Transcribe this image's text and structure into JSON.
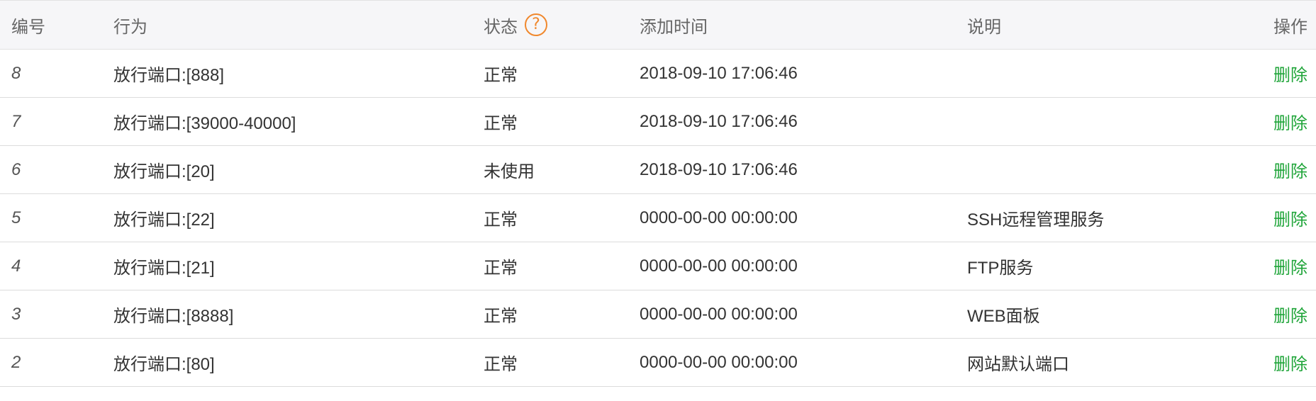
{
  "table": {
    "headers": {
      "id": "编号",
      "action": "行为",
      "status": "状态",
      "help_icon": "?",
      "time": "添加时间",
      "desc": "说明",
      "op": "操作"
    },
    "rows": [
      {
        "id": "8",
        "action": "放行端口:[888]",
        "status": "正常",
        "time": "2018-09-10 17:06:46",
        "desc": "",
        "op": "删除"
      },
      {
        "id": "7",
        "action": "放行端口:[39000-40000]",
        "status": "正常",
        "time": "2018-09-10 17:06:46",
        "desc": "",
        "op": "删除"
      },
      {
        "id": "6",
        "action": "放行端口:[20]",
        "status": "未使用",
        "time": "2018-09-10 17:06:46",
        "desc": "",
        "op": "删除"
      },
      {
        "id": "5",
        "action": "放行端口:[22]",
        "status": "正常",
        "time": "0000-00-00 00:00:00",
        "desc": "SSH远程管理服务",
        "op": "删除"
      },
      {
        "id": "4",
        "action": "放行端口:[21]",
        "status": "正常",
        "time": "0000-00-00 00:00:00",
        "desc": "FTP服务",
        "op": "删除"
      },
      {
        "id": "3",
        "action": "放行端口:[8888]",
        "status": "正常",
        "time": "0000-00-00 00:00:00",
        "desc": "WEB面板",
        "op": "删除"
      },
      {
        "id": "2",
        "action": "放行端口:[80]",
        "status": "正常",
        "time": "0000-00-00 00:00:00",
        "desc": "网站默认端口",
        "op": "删除"
      }
    ]
  },
  "colors": {
    "link": "#20a53a",
    "help_icon": "#f0882d",
    "header_bg": "#f6f6f8"
  }
}
